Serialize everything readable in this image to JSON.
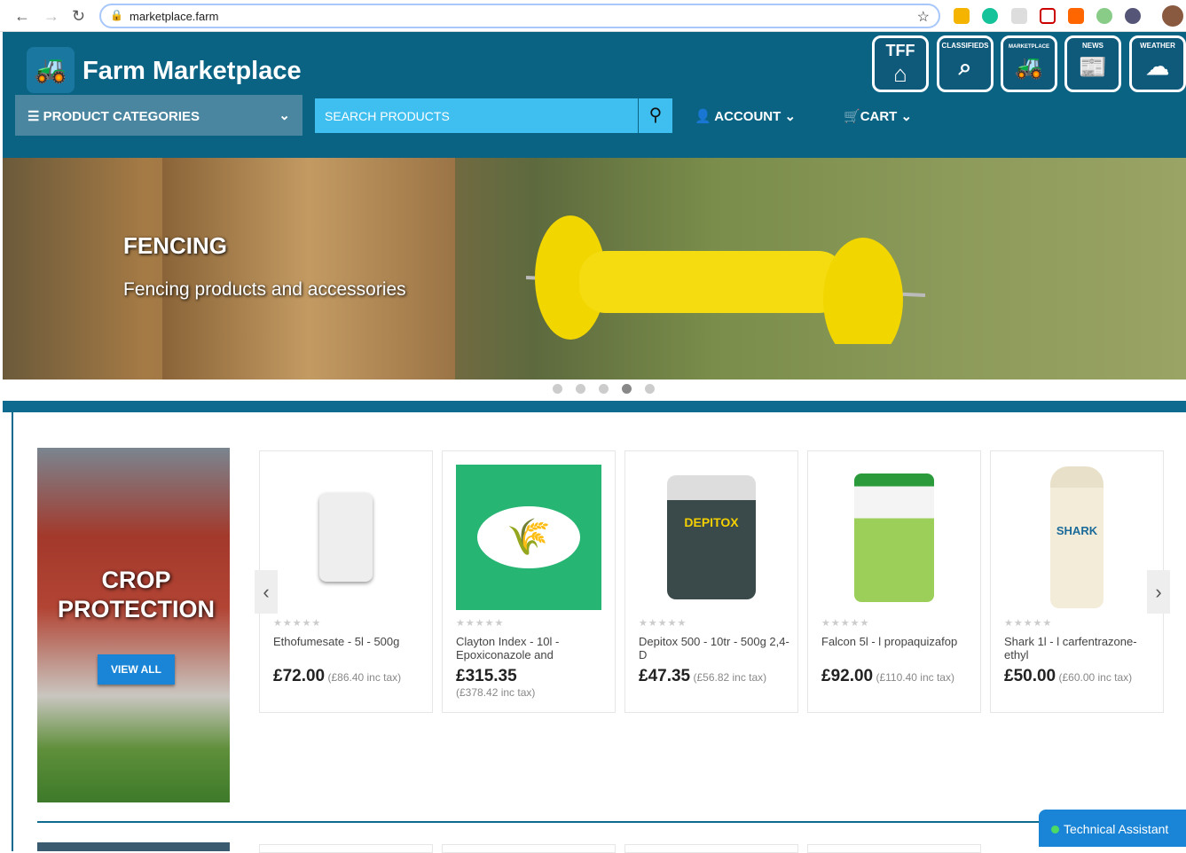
{
  "browser": {
    "url": "marketplace.farm"
  },
  "header": {
    "site_name": "Farm Marketplace",
    "badges": [
      {
        "label": "TFF",
        "icon": "farm-icon"
      },
      {
        "label": "CLASSIFIEDS",
        "icon": "magnifier-icon"
      },
      {
        "label": "MARKETPLACE",
        "icon": "tractor-icon"
      },
      {
        "label": "NEWS",
        "icon": "newspaper-icon"
      },
      {
        "label": "WEATHER",
        "icon": "weather-icon"
      }
    ],
    "categories_label": "PRODUCT CATEGORIES",
    "search_placeholder": "SEARCH PRODUCTS",
    "account_label": "ACCOUNT",
    "cart_label": "CART"
  },
  "hero": {
    "title": "FENCING",
    "subtitle": "Fencing products and accessories",
    "slides": 5,
    "active_slide": 4
  },
  "category_tile": {
    "title": "CROP PROTECTION",
    "button": "VIEW ALL"
  },
  "products": [
    {
      "name": "Ethofumesate - 5l - 500g",
      "price": "£72.00",
      "inc_tax": "(£86.40 inc tax)",
      "rating": 0,
      "image_color": "#ffffff"
    },
    {
      "name": "Clayton Index - 10l - Epoxiconazole and",
      "price": "£315.35",
      "inc_tax": "(£378.42 inc tax)",
      "rating": 0,
      "image_color": "#27b574"
    },
    {
      "name": "Depitox 500 - 10tr - 500g 2,4-D",
      "price": "£47.35",
      "inc_tax": "(£56.82 inc tax)",
      "rating": 0,
      "image_color": "#ffffff"
    },
    {
      "name": "Falcon 5l - l propaquizafop",
      "price": "£92.00",
      "inc_tax": "(£110.40 inc tax)",
      "rating": 0,
      "image_color": "#ffffff"
    },
    {
      "name": "Shark 1l - l carfentrazone-ethyl",
      "price": "£50.00",
      "inc_tax": "(£60.00 inc tax)",
      "rating": 0,
      "image_color": "#ffffff"
    }
  ],
  "assistant": {
    "label": "Technical Assistant"
  },
  "colors": {
    "header": "#0b6384",
    "search": "#3fbfef",
    "button": "#1a85d6"
  }
}
